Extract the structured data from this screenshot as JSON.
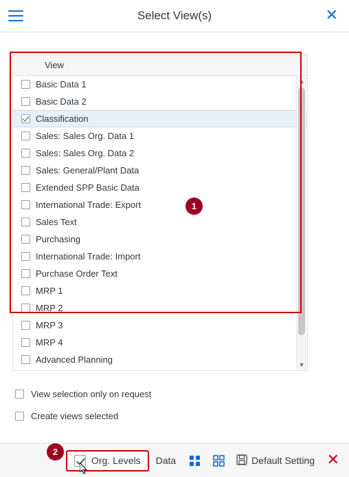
{
  "window": {
    "title": "Select View(s)",
    "menu_icon": "hamburger-icon",
    "close_icon": "close-icon"
  },
  "table": {
    "header": "View",
    "rows": [
      {
        "label": "Basic Data 1",
        "checked": false,
        "selected": false
      },
      {
        "label": "Basic Data 2",
        "checked": false,
        "selected": false
      },
      {
        "label": "Classification",
        "checked": true,
        "selected": true
      },
      {
        "label": "Sales: Sales Org. Data 1",
        "checked": false,
        "selected": false
      },
      {
        "label": "Sales: Sales Org. Data 2",
        "checked": false,
        "selected": false
      },
      {
        "label": "Sales: General/Plant Data",
        "checked": false,
        "selected": false
      },
      {
        "label": "Extended SPP Basic Data",
        "checked": false,
        "selected": false
      },
      {
        "label": "International Trade: Export",
        "checked": false,
        "selected": false
      },
      {
        "label": "Sales Text",
        "checked": false,
        "selected": false
      },
      {
        "label": "Purchasing",
        "checked": false,
        "selected": false
      },
      {
        "label": "International Trade: Import",
        "checked": false,
        "selected": false
      },
      {
        "label": "Purchase Order Text",
        "checked": false,
        "selected": false
      },
      {
        "label": "MRP 1",
        "checked": false,
        "selected": false
      },
      {
        "label": "MRP 2",
        "checked": false,
        "selected": false
      },
      {
        "label": "MRP 3",
        "checked": false,
        "selected": false
      },
      {
        "label": "MRP 4",
        "checked": false,
        "selected": false
      },
      {
        "label": "Advanced Planning",
        "checked": false,
        "selected": false
      }
    ]
  },
  "options": [
    {
      "label": "View selection only on request",
      "checked": false
    },
    {
      "label": "Create views selected",
      "checked": false
    }
  ],
  "footer": {
    "org_levels_label": "Org. Levels",
    "data_label": "Data",
    "default_setting_label": "Default Setting",
    "grid_icon_1": "grid-four-dots-icon",
    "grid_icon_2": "grid-squares-icon",
    "save_icon": "floppy-disk-icon",
    "close_icon": "close-icon"
  },
  "annotations": [
    {
      "number": "1"
    },
    {
      "number": "2"
    }
  ],
  "colors": {
    "accent": "#0a6ed1",
    "annotation": "#cc0000",
    "badge": "#a00020",
    "selection": "#e8f0f9"
  }
}
